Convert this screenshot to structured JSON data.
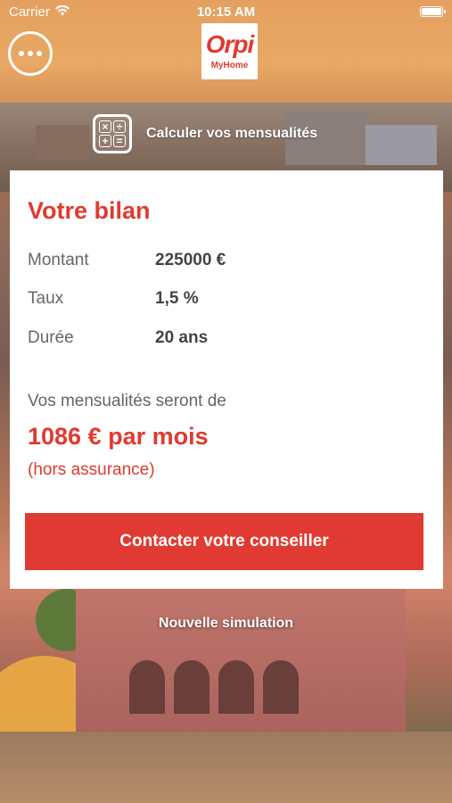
{
  "status_bar": {
    "carrier": "Carrier",
    "time": "10:15 AM",
    "wifi_icon": "wifi-icon",
    "battery_icon": "battery-icon"
  },
  "header": {
    "menu_icon": "more-dots-icon",
    "logo": {
      "main": "Orpi",
      "sub": "MyHome"
    }
  },
  "calculator": {
    "icon": "calculator-icon",
    "symbols": [
      "×",
      "÷",
      "+",
      "="
    ],
    "label": "Calculer vos mensualités"
  },
  "summary": {
    "title": "Votre bilan",
    "rows": [
      {
        "label": "Montant",
        "value": "225000 €"
      },
      {
        "label": "Taux",
        "value": "1,5 %"
      },
      {
        "label": "Durée",
        "value": "20 ans"
      }
    ],
    "intro": "Vos mensualités seront de",
    "monthly": "1086 € par mois",
    "note": "(hors assurance)",
    "cta_label": "Contacter votre conseiller"
  },
  "new_simulation_label": "Nouvelle simulation",
  "colors": {
    "accent": "#e13a2f",
    "button": "#e03a32",
    "text_muted": "#666666",
    "text_strong": "#444444"
  }
}
